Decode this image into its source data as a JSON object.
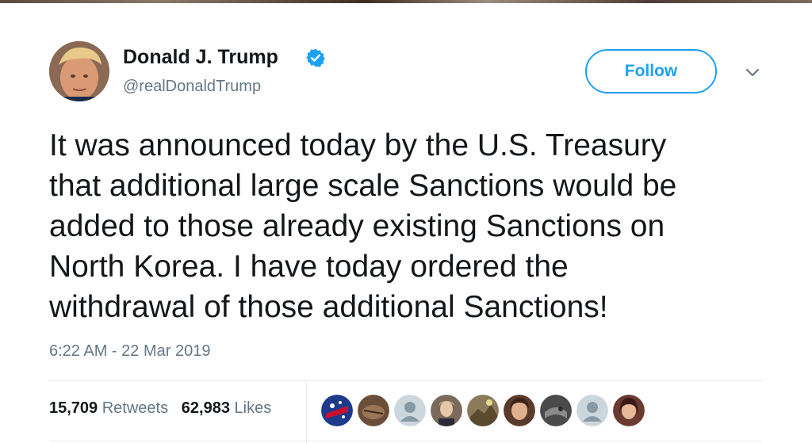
{
  "tweet": {
    "author_name": "Donald J. Trump",
    "handle": "@realDonaldTrump",
    "follow_label": "Follow",
    "text": "It was announced today by the U.S. Treasury\nthat additional large scale Sanctions would be\nadded to those already existing Sanctions on\nNorth Korea. I have today ordered the\nwithdrawal of those additional Sanctions!",
    "timestamp": "6:22 AM - 22 Mar 2019",
    "retweets_count": "15,709",
    "retweets_label": "Retweets",
    "likes_count": "62,983",
    "likes_label": "Likes"
  },
  "colors": {
    "accent": "#1da1f2",
    "secondary_text": "#657786",
    "primary_text": "#14171a",
    "divider": "#e6ecf0"
  },
  "icons": {
    "verified": "verified-badge-icon",
    "menu": "chevron-down-icon",
    "default_avatar": "default-user-icon"
  }
}
